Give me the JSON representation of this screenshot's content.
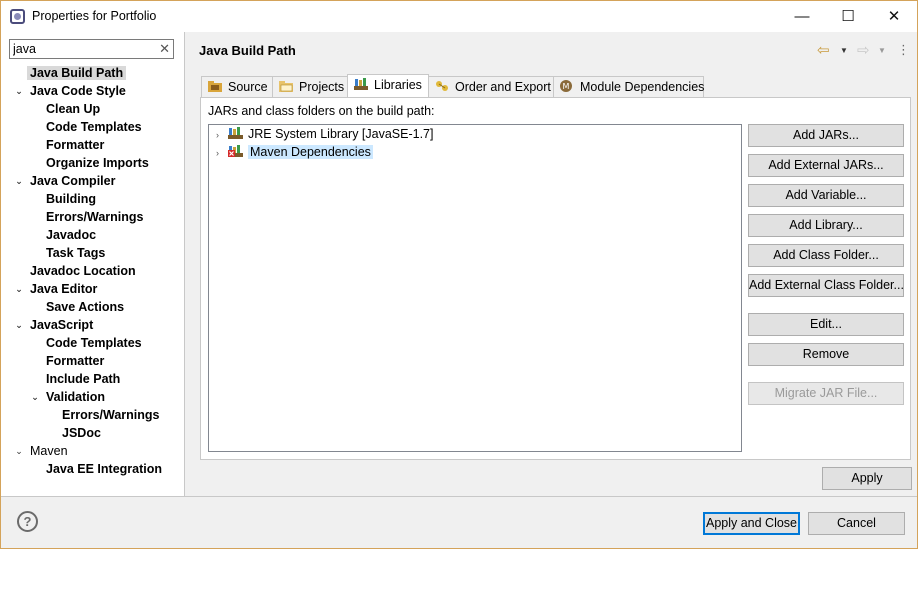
{
  "window": {
    "title": "Properties for Portfolio",
    "minimize_glyph": "—",
    "maximize_glyph": "☐",
    "close_glyph": "✕"
  },
  "filter": {
    "value": "java",
    "clear_glyph": "✕"
  },
  "tree": [
    {
      "label": "Java Build Path",
      "indent": 0,
      "expander": "",
      "selected": true,
      "bold": true
    },
    {
      "label": "Java Code Style",
      "indent": 0,
      "expander": "⌄",
      "bold": true
    },
    {
      "label": "Clean Up",
      "indent": 1,
      "expander": "",
      "bold": true
    },
    {
      "label": "Code Templates",
      "indent": 1,
      "expander": "",
      "bold": true
    },
    {
      "label": "Formatter",
      "indent": 1,
      "expander": "",
      "bold": true
    },
    {
      "label": "Organize Imports",
      "indent": 1,
      "expander": "",
      "bold": true
    },
    {
      "label": "Java Compiler",
      "indent": 0,
      "expander": "⌄",
      "bold": true
    },
    {
      "label": "Building",
      "indent": 1,
      "expander": "",
      "bold": true
    },
    {
      "label": "Errors/Warnings",
      "indent": 1,
      "expander": "",
      "bold": true
    },
    {
      "label": "Javadoc",
      "indent": 1,
      "expander": "",
      "bold": true
    },
    {
      "label": "Task Tags",
      "indent": 1,
      "expander": "",
      "bold": true
    },
    {
      "label": "Javadoc Location",
      "indent": 0,
      "expander": "",
      "bold": true
    },
    {
      "label": "Java Editor",
      "indent": 0,
      "expander": "⌄",
      "bold": true
    },
    {
      "label": "Save Actions",
      "indent": 1,
      "expander": "",
      "bold": true
    },
    {
      "label": "JavaScript",
      "indent": 0,
      "expander": "⌄",
      "bold": true
    },
    {
      "label": "Code Templates",
      "indent": 1,
      "expander": "",
      "bold": true
    },
    {
      "label": "Formatter",
      "indent": 1,
      "expander": "",
      "bold": true
    },
    {
      "label": "Include Path",
      "indent": 1,
      "expander": "",
      "bold": true
    },
    {
      "label": "Validation",
      "indent": 1,
      "expander": "⌄",
      "bold": true
    },
    {
      "label": "Errors/Warnings",
      "indent": 2,
      "expander": "",
      "bold": true
    },
    {
      "label": "JSDoc",
      "indent": 2,
      "expander": "",
      "bold": true
    },
    {
      "label": "Maven",
      "indent": 0,
      "expander": "⌄",
      "bold": false
    },
    {
      "label": "Java EE Integration",
      "indent": 1,
      "expander": "",
      "bold": true
    }
  ],
  "page": {
    "title": "Java Build Path",
    "nav": {
      "back_glyph": "⇦",
      "forward_glyph": "⇨",
      "dropdown_glyph": "▼",
      "menu_glyph": "⋮"
    }
  },
  "tabs": [
    {
      "label": "Source",
      "icon": "source-folder-icon",
      "active": false
    },
    {
      "label": "Projects",
      "icon": "projects-folder-icon",
      "active": false
    },
    {
      "label": "Libraries",
      "icon": "libraries-icon",
      "active": true
    },
    {
      "label": "Order and Export",
      "icon": "order-export-icon",
      "active": false
    },
    {
      "label": "Module Dependencies",
      "icon": "module-icon",
      "active": false
    }
  ],
  "libraries": {
    "label": "JARs and class folders on the build path:",
    "items": [
      {
        "label": "JRE System Library [JavaSE-1.7]",
        "icon": "library-icon",
        "selected": false,
        "error": false
      },
      {
        "label": "Maven Dependencies",
        "icon": "library-error-icon",
        "selected": true,
        "error": true
      }
    ],
    "expand_glyph": "›"
  },
  "buttons": [
    {
      "label": "Add JARs...",
      "disabled": false
    },
    {
      "label": "Add External JARs...",
      "disabled": false
    },
    {
      "label": "Add Variable...",
      "disabled": false
    },
    {
      "label": "Add Library...",
      "disabled": false
    },
    {
      "label": "Add Class Folder...",
      "disabled": false
    },
    {
      "label": "Add External Class Folder...",
      "disabled": false
    },
    {
      "label": "Edit...",
      "disabled": false
    },
    {
      "label": "Remove",
      "disabled": false
    },
    {
      "label": "Migrate JAR File...",
      "disabled": true
    }
  ],
  "apply_label": "Apply",
  "footer": {
    "help_glyph": "?",
    "apply_close_label": "Apply and Close",
    "cancel_label": "Cancel"
  },
  "colors": {
    "window_border": "#d4a35a",
    "selection": "#cce8ff",
    "default_button_border": "#0078d7"
  }
}
